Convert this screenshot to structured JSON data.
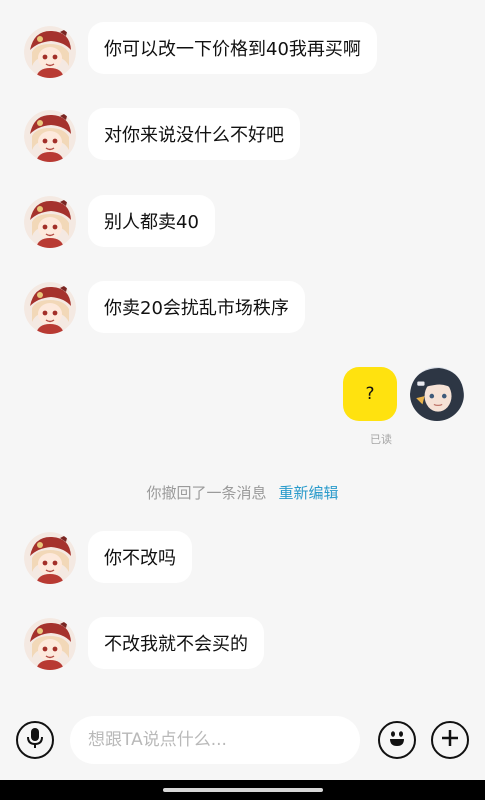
{
  "messages_left": [
    {
      "text": "你可以改一下价格到40我再买啊"
    },
    {
      "text": "对你来说没什么不好吧"
    },
    {
      "text": "别人都卖40"
    },
    {
      "text": "你卖20会扰乱市场秩序"
    }
  ],
  "message_right": {
    "text": "?",
    "status": "已读"
  },
  "recall_notice": {
    "text": "你撤回了一条消息",
    "action": "重新编辑"
  },
  "messages_left_after": [
    {
      "text": "你不改吗"
    },
    {
      "text": "不改我就不会买的"
    }
  ],
  "input_bar": {
    "placeholder": "想跟TA说点什么...",
    "voice_icon": "microphone-icon",
    "emoji_icon": "emoji-icon",
    "plus_icon": "plus-icon"
  },
  "colors": {
    "background": "#f6f6f6",
    "bubble_other": "#ffffff",
    "bubble_self": "#ffe20f",
    "link": "#2a9bcb"
  }
}
